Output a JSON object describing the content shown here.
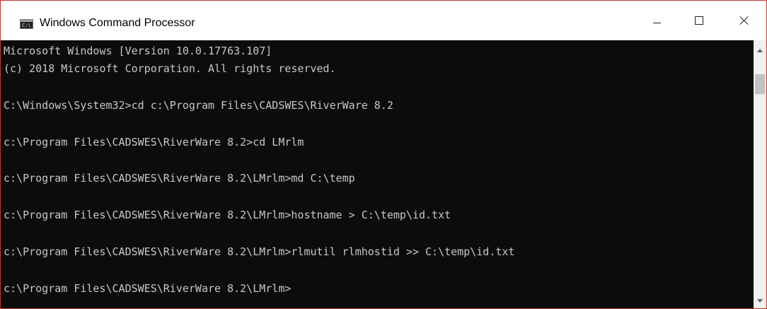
{
  "window": {
    "title": "Windows Command Processor",
    "icon": "command-prompt-icon",
    "icon_glyph": "C:\\",
    "accent_border": "#c0392b"
  },
  "caption_buttons": {
    "minimize_icon": "minimize-icon",
    "maximize_icon": "maximize-icon",
    "close_icon": "close-icon"
  },
  "console": {
    "background": "#0c0c0c",
    "foreground": "#c8c8c8",
    "lines": [
      "Microsoft Windows [Version 10.0.17763.107]",
      "(c) 2018 Microsoft Corporation. All rights reserved.",
      "C:\\Windows\\System32>cd c:\\Program Files\\CADSWES\\RiverWare 8.2",
      "c:\\Program Files\\CADSWES\\RiverWare 8.2>cd LMrlm",
      "c:\\Program Files\\CADSWES\\RiverWare 8.2\\LMrlm>md C:\\temp",
      "c:\\Program Files\\CADSWES\\RiverWare 8.2\\LMrlm>hostname > C:\\temp\\id.txt",
      "c:\\Program Files\\CADSWES\\RiverWare 8.2\\LMrlm>rlmutil rlmhostid >> C:\\temp\\id.txt",
      "c:\\Program Files\\CADSWES\\RiverWare 8.2\\LMrlm>"
    ]
  },
  "scrollbar": {
    "up_icon": "scroll-up-arrow-icon",
    "down_icon": "scroll-down-arrow-icon"
  }
}
